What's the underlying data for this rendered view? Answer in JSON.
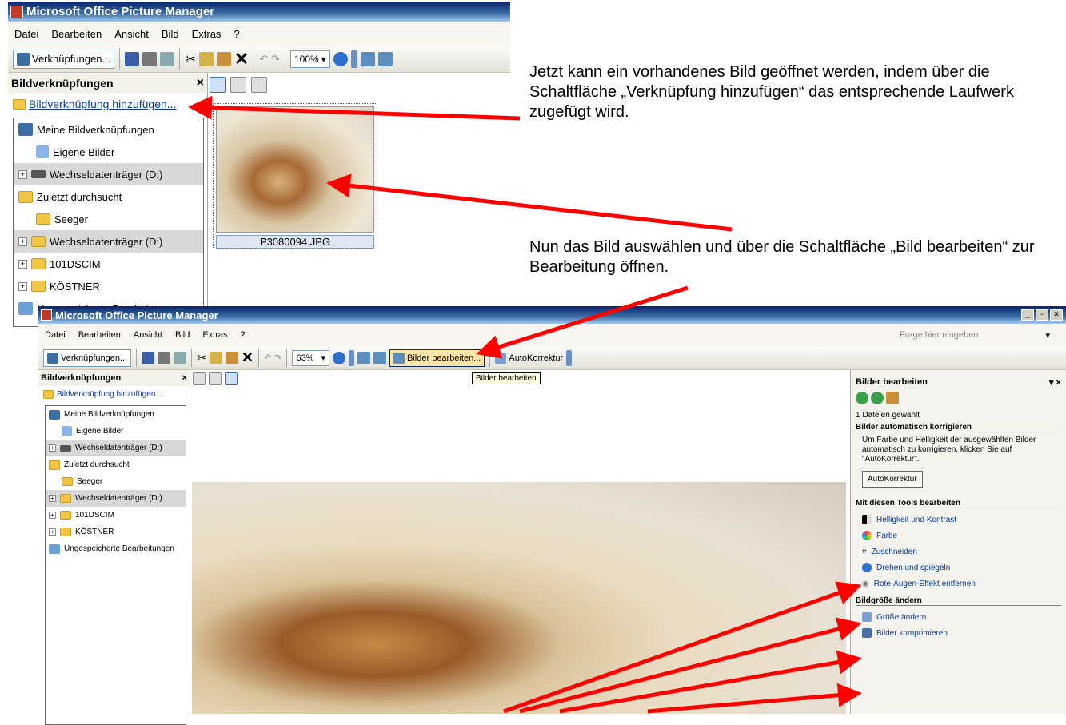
{
  "window_title": "Microsoft Office Picture Manager",
  "menu": [
    "Datei",
    "Bearbeiten",
    "Ansicht",
    "Bild",
    "Extras",
    "?"
  ],
  "toolbar": {
    "shortcuts_label": "Verknüpfungen...",
    "zoom_top": "100%",
    "zoom_bottom": "63%",
    "edit_pictures": "Bilder bearbeiten...",
    "autocorrect": "AutoKorrektur"
  },
  "tooltip": "Bilder bearbeiten",
  "help_box": "Frage hier eingeben",
  "left_pane": {
    "title": "Bildverknüpfungen",
    "add_link": "Bildverknüpfung hinzufügen...",
    "tree": [
      "Meine Bildverknüpfungen",
      "Eigene Bilder",
      "Wechseldatenträger (D:)",
      "Zuletzt durchsucht",
      "Seeger",
      "Wechseldatenträger (D:)",
      "101DSCIM",
      "KÖSTNER",
      "Ungespeicherte Bearbeitungen"
    ]
  },
  "thumbnail": {
    "filename": "P3080094.JPG"
  },
  "task_pane": {
    "title": "Bilder bearbeiten",
    "files_selected": "1 Dateien gewählt",
    "auto_heading": "Bilder automatisch korrigieren",
    "auto_text": "Um Farbe und Helligkeit der ausgewählten Bilder automatisch zu korrigieren, klicken Sie auf \"AutoKorrektur\".",
    "auto_button": "AutoKorrektur",
    "tools_heading": "Mit diesen Tools bearbeiten",
    "tools": [
      "Helligkeit und Kontrast",
      "Farbe",
      "Zuschneiden",
      "Drehen und spiegeln",
      "Rote-Augen-Effekt entfernen"
    ],
    "resize_heading": "Bildgröße ändern",
    "resize": [
      "Größe ändern",
      "Bilder komprimieren"
    ]
  },
  "annotations": {
    "text1": "Jetzt kann ein vorhandenes Bild geöffnet werden, indem über die Schaltfläche „Verknüpfung hinzufügen“ das entsprechende Laufwerk zugefügt wird.",
    "text2": "Nun das Bild auswählen und über die Schaltfläche „Bild bearbeiten“ zur Bearbeitung öffnen."
  },
  "colors": {
    "arrow": "#ff0000",
    "titlebar": "#0a246a",
    "link": "#0b3d91"
  }
}
